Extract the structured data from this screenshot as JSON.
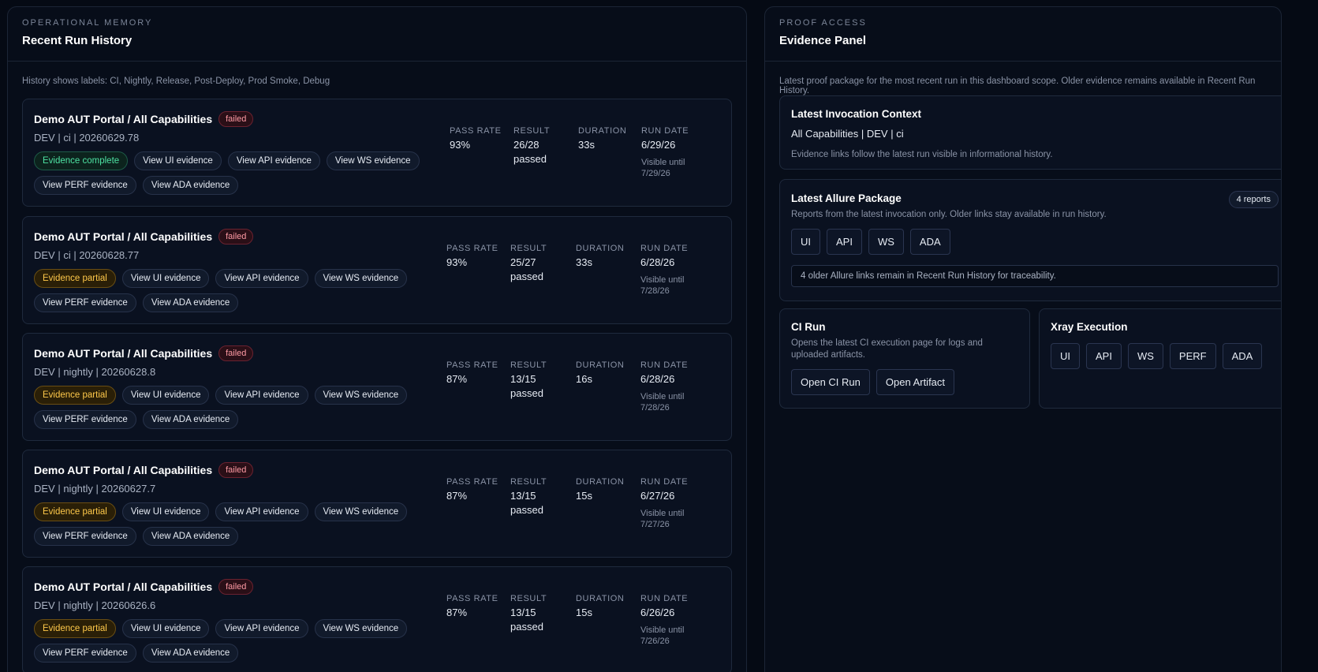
{
  "history": {
    "eyebrow": "OPERATIONAL MEMORY",
    "title": "Recent Run History",
    "note": "History shows labels: CI, Nightly, Release, Post-Deploy, Prod Smoke, Debug",
    "metric_labels": {
      "pass_rate": "PASS RATE",
      "result": "RESULT",
      "duration": "DURATION",
      "run_date": "RUN DATE"
    },
    "evidence_links": {
      "ui": "View UI evidence",
      "api": "View API evidence",
      "ws": "View WS evidence",
      "perf": "View PERF evidence",
      "ada": "View ADA evidence"
    },
    "runs": [
      {
        "title": "Demo AUT Portal / All Capabilities",
        "status": "failed",
        "subtitle": "DEV | ci | 20260629.78",
        "evidence": "Evidence complete",
        "pass_rate": "93%",
        "result_line1": "26/28",
        "result_line2": "passed",
        "duration": "33s",
        "run_date": "6/29/26",
        "visible_line1": "Visible until",
        "visible_line2": "7/29/26"
      },
      {
        "title": "Demo AUT Portal / All Capabilities",
        "status": "failed",
        "subtitle": "DEV | ci | 20260628.77",
        "evidence": "Evidence partial",
        "pass_rate": "93%",
        "result_line1": "25/27",
        "result_line2": "passed",
        "duration": "33s",
        "run_date": "6/28/26",
        "visible_line1": "Visible until",
        "visible_line2": "7/28/26"
      },
      {
        "title": "Demo AUT Portal / All Capabilities",
        "status": "failed",
        "subtitle": "DEV | nightly | 20260628.8",
        "evidence": "Evidence partial",
        "pass_rate": "87%",
        "result_line1": "13/15",
        "result_line2": "passed",
        "duration": "16s",
        "run_date": "6/28/26",
        "visible_line1": "Visible until",
        "visible_line2": "7/28/26"
      },
      {
        "title": "Demo AUT Portal / All Capabilities",
        "status": "failed",
        "subtitle": "DEV | nightly | 20260627.7",
        "evidence": "Evidence partial",
        "pass_rate": "87%",
        "result_line1": "13/15",
        "result_line2": "passed",
        "duration": "15s",
        "run_date": "6/27/26",
        "visible_line1": "Visible until",
        "visible_line2": "7/27/26"
      },
      {
        "title": "Demo AUT Portal / All Capabilities",
        "status": "failed",
        "subtitle": "DEV | nightly | 20260626.6",
        "evidence": "Evidence partial",
        "pass_rate": "87%",
        "result_line1": "13/15",
        "result_line2": "passed",
        "duration": "15s",
        "run_date": "6/26/26",
        "visible_line1": "Visible until",
        "visible_line2": "7/26/26"
      }
    ]
  },
  "evidence": {
    "eyebrow": "PROOF ACCESS",
    "title": "Evidence Panel",
    "note": "Latest proof package for the most recent run in this dashboard scope. Older evidence remains available in Recent Run History.",
    "invocation": {
      "title": "Latest Invocation Context",
      "context": "All Capabilities | DEV | ci",
      "text": "Evidence links follow the latest run visible in informational history."
    },
    "allure": {
      "title": "Latest Allure Package",
      "count": "4 reports",
      "text": "Reports from the latest invocation only. Older links stay available in run history.",
      "buttons": [
        "UI",
        "API",
        "WS",
        "ADA"
      ],
      "older_note": "4 older Allure links remain in Recent Run History for traceability."
    },
    "ci": {
      "title": "CI Run",
      "text": "Opens the latest CI execution page for logs and uploaded artifacts.",
      "open_run": "Open CI Run",
      "open_artifact": "Open Artifact"
    },
    "xray": {
      "title": "Xray Execution",
      "buttons": [
        "UI",
        "API",
        "WS",
        "PERF",
        "ADA"
      ]
    }
  },
  "colors": {
    "background": "#050a14",
    "failed": "#ff9aa4",
    "complete": "#4ee3a3",
    "partial": "#ffc94a"
  }
}
